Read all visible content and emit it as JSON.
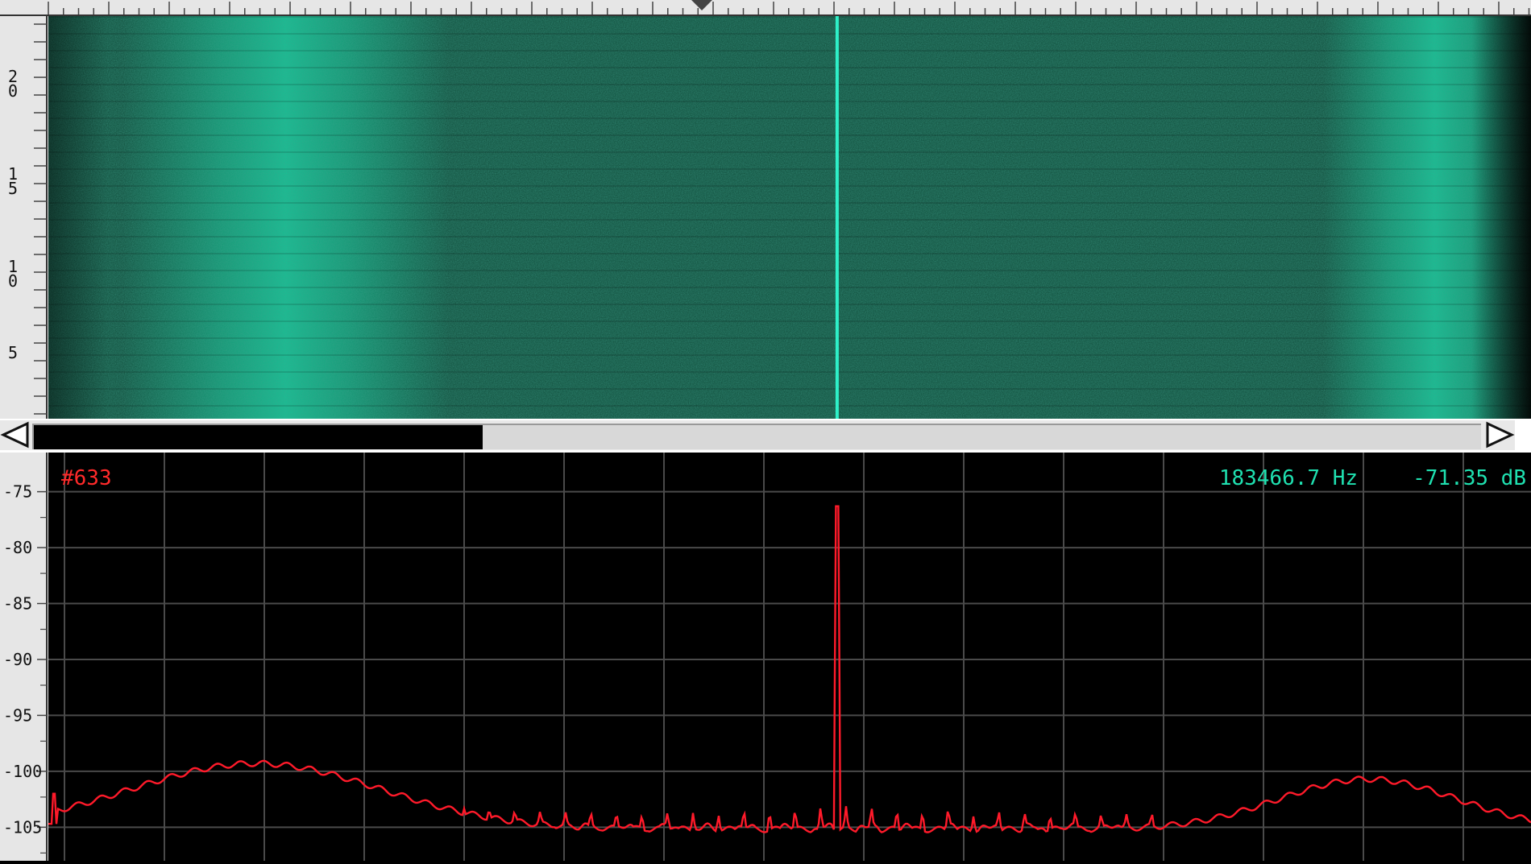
{
  "colors": {
    "panel_bg": "#e6e6e6",
    "waterfall_base": "#0f4a38",
    "waterfall_band": "#12d8a4",
    "waterfall_line": "#2ef0c8",
    "trace": "#ff1a2a",
    "grid": "#4a4a4a",
    "marker_label": "#ff2a2a",
    "readout": "#1fe0b0"
  },
  "icons": {
    "scroll_left": "left-arrow-icon",
    "scroll_right": "right-arrow-icon",
    "ruler_marker": "triangle-down-icon"
  },
  "waterfall": {
    "y_labels": [
      "2 0",
      "1 5",
      "1 0",
      "5"
    ],
    "signal_line_freq_fraction": 0.532,
    "bands": [
      {
        "center_fraction": 0.16,
        "width_fraction": 0.22
      },
      {
        "center_fraction": 0.935,
        "width_fraction": 0.15
      }
    ]
  },
  "scrollbar": {
    "thumb_fraction": 0.31
  },
  "spectrum": {
    "marker_label": "#633",
    "frequency_readout": "183466.7 Hz",
    "level_readout": "-71.35 dB",
    "y_labels": [
      "-75",
      "-80",
      "-85",
      "-90",
      "-95",
      "-100",
      "-105"
    ],
    "y_ticks": [
      -75,
      -80,
      -85,
      -90,
      -95,
      -100,
      -105
    ],
    "y_range": [
      -108,
      -71.5
    ],
    "noise_floor": -105.2,
    "peak": {
      "x_fraction": 0.532,
      "value": -76.3
    },
    "humps": [
      {
        "x_fraction": 0.14,
        "width_fraction": 0.085,
        "value": -99.3
      },
      {
        "x_fraction": 0.89,
        "width_fraction": 0.06,
        "value": -100.7
      }
    ],
    "comb": {
      "start_fraction": 0.28,
      "end_fraction": 0.745,
      "spacing_fraction": 0.0172,
      "height": 1.9
    }
  }
}
